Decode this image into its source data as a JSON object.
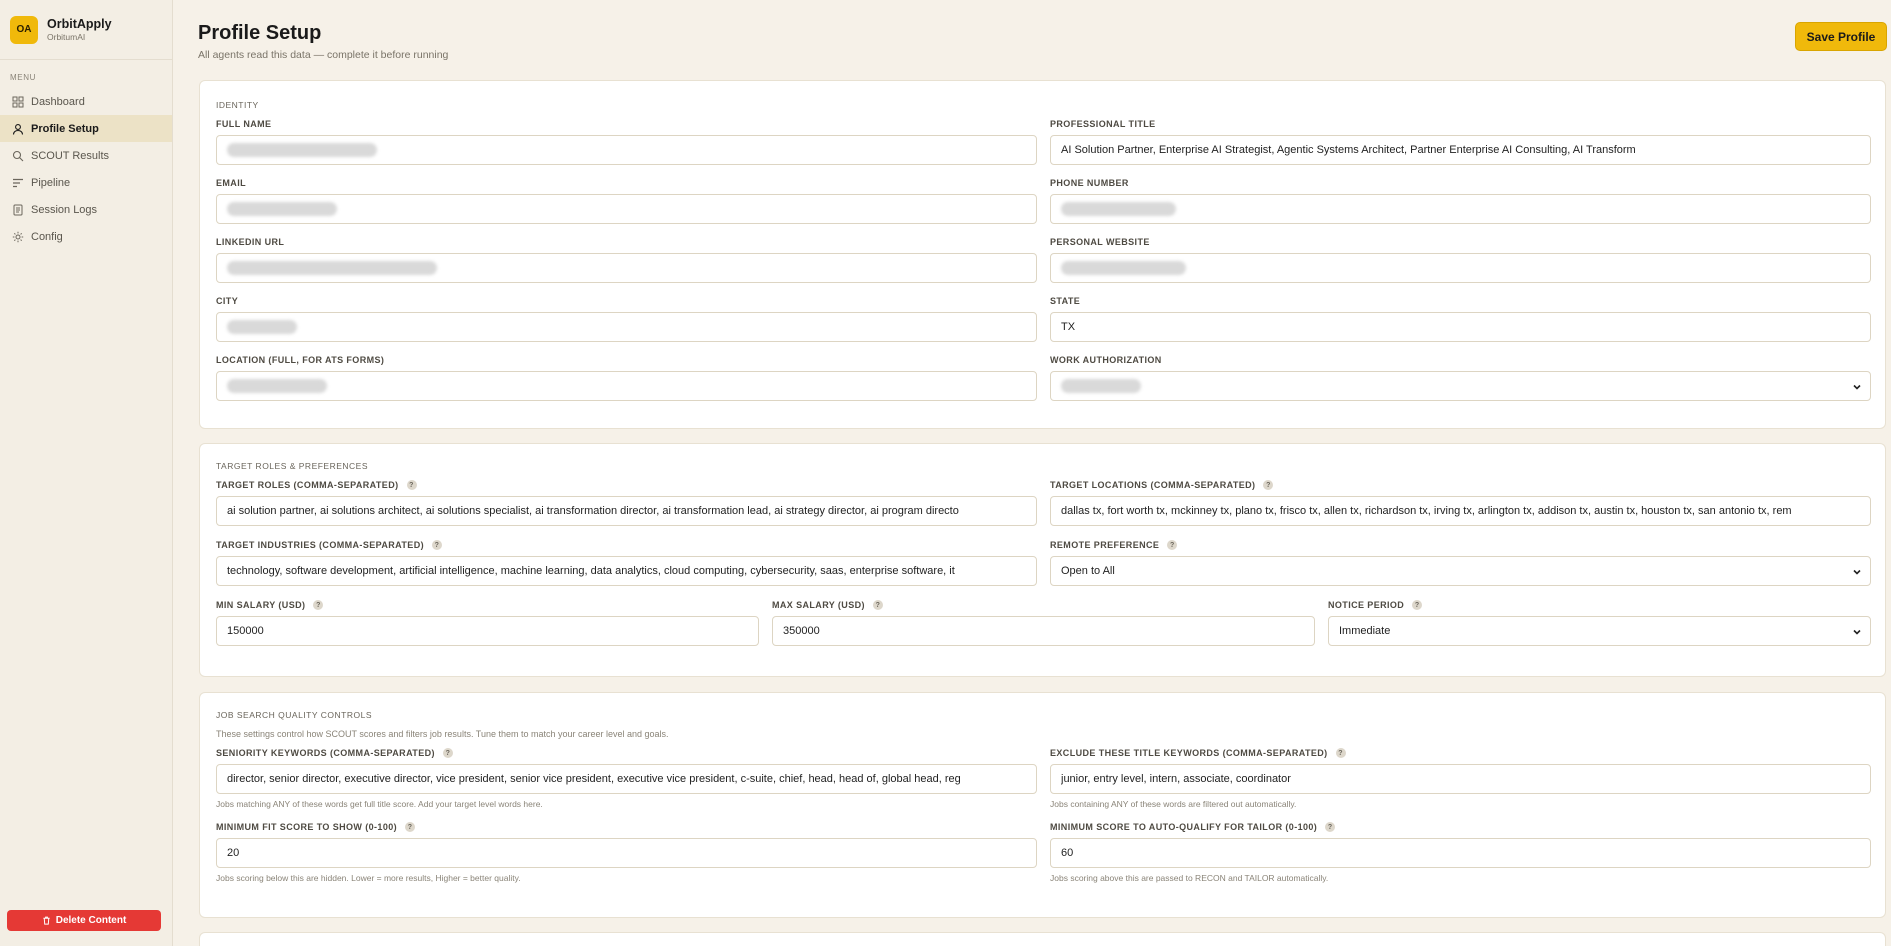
{
  "app": {
    "logo": "OA",
    "name": "OrbitApply",
    "org": "OrbitumAI"
  },
  "sidebar": {
    "menu_label": "MENU",
    "items": [
      {
        "label": "Dashboard",
        "icon": "dashboard-icon"
      },
      {
        "label": "Profile Setup",
        "icon": "user-icon"
      },
      {
        "label": "SCOUT Results",
        "icon": "search-icon"
      },
      {
        "label": "Pipeline",
        "icon": "pipeline-icon"
      },
      {
        "label": "Session Logs",
        "icon": "document-icon"
      },
      {
        "label": "Config",
        "icon": "gear-icon"
      }
    ],
    "delete_label": "Delete Content"
  },
  "header": {
    "title": "Profile Setup",
    "subtitle": "All agents read this data — complete it before running",
    "save_label": "Save Profile"
  },
  "identity": {
    "title": "IDENTITY",
    "full_name": {
      "label": "FULL NAME"
    },
    "professional_title": {
      "label": "PROFESSIONAL TITLE",
      "value": "AI Solution Partner, Enterprise AI Strategist, Agentic Systems Architect, Partner Enterprise AI Consulting, AI Transform"
    },
    "email": {
      "label": "EMAIL"
    },
    "phone": {
      "label": "PHONE NUMBER"
    },
    "linkedin": {
      "label": "LINKEDIN URL"
    },
    "website": {
      "label": "PERSONAL WEBSITE"
    },
    "city": {
      "label": "CITY"
    },
    "state": {
      "label": "STATE",
      "value": "TX"
    },
    "location": {
      "label": "LOCATION (FULL, FOR ATS FORMS)"
    },
    "work_auth": {
      "label": "WORK AUTHORIZATION"
    }
  },
  "targets": {
    "title": "TARGET ROLES & PREFERENCES",
    "roles": {
      "label": "TARGET ROLES (COMMA-SEPARATED)",
      "value": "ai solution partner, ai solutions architect, ai solutions specialist, ai transformation director, ai transformation lead, ai strategy director, ai program directo"
    },
    "locations": {
      "label": "TARGET LOCATIONS (COMMA-SEPARATED)",
      "value": "dallas tx, fort worth tx, mckinney tx, plano tx, frisco tx, allen tx, richardson tx, irving tx, arlington tx, addison tx, austin tx, houston tx, san antonio tx, rem"
    },
    "industries": {
      "label": "TARGET INDUSTRIES (COMMA-SEPARATED)",
      "value": "technology, software development, artificial intelligence, machine learning, data analytics, cloud computing, cybersecurity, saas, enterprise software, it"
    },
    "remote": {
      "label": "REMOTE PREFERENCE",
      "value": "Open to All"
    },
    "min_salary": {
      "label": "MIN SALARY (USD)",
      "value": "150000"
    },
    "max_salary": {
      "label": "MAX SALARY (USD)",
      "value": "350000"
    },
    "notice": {
      "label": "NOTICE PERIOD",
      "value": "Immediate"
    }
  },
  "quality": {
    "title": "JOB SEARCH QUALITY CONTROLS",
    "desc": "These settings control how SCOUT scores and filters job results. Tune them to match your career level and goals.",
    "seniority": {
      "label": "SENIORITY KEYWORDS (COMMA-SEPARATED)",
      "value": "director, senior director, executive director, vice president, senior vice president, executive vice president, c-suite, chief, head, head of, global head, reg",
      "hint": "Jobs matching ANY of these words get full title score. Add your target level words here."
    },
    "exclude": {
      "label": "EXCLUDE THESE TITLE KEYWORDS (COMMA-SEPARATED)",
      "value": "junior, entry level, intern, associate, coordinator",
      "hint": "Jobs containing ANY of these words are filtered out automatically."
    },
    "min_fit": {
      "label": "MINIMUM FIT SCORE TO SHOW (0-100)",
      "value": "20",
      "hint": "Jobs scoring below this are hidden. Lower = more results, Higher = better quality."
    },
    "min_auto": {
      "label": "MINIMUM SCORE TO AUTO-QUALIFY FOR TAILOR (0-100)",
      "value": "60",
      "hint": "Jobs scoring above this are passed to RECON and TAILOR automatically."
    }
  },
  "help_glyph": "?",
  "colors": {
    "accent": "#f0b90b",
    "danger": "#e53935",
    "background": "#f6f1e8"
  }
}
